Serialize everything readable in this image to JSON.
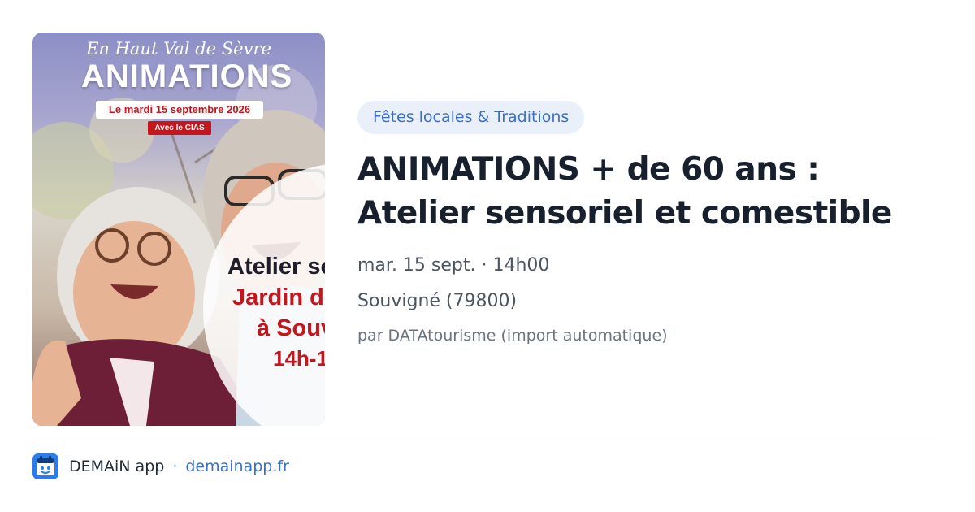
{
  "poster": {
    "subtitle": "En Haut Val de Sèvre",
    "title": "ANIMATIONS",
    "date": "Le mardi 15 septembre 2026",
    "organizer": "Avec le CIAS",
    "line1": "Atelier se",
    "line2": "Jardin de",
    "line3": "à Souv",
    "line4": "14h-1"
  },
  "event": {
    "category": "Fêtes locales & Traditions",
    "title": "ANIMATIONS + de 60 ans : Atelier sensoriel et comestible",
    "datetime": "mar. 15 sept. · 14h00",
    "location": "Souvigné (79800)",
    "source": "par DATAtourisme (import automatique)"
  },
  "footer": {
    "app_icon": "demain-app-icon",
    "app_name": "DEMAiN app",
    "separator": "·",
    "domain": "demainapp.fr"
  },
  "colors": {
    "accent": "#3a6fc9",
    "badge_bg": "#eaf0fa",
    "poster_red": "#c4161c",
    "app_icon_bg": "#2b7de9"
  }
}
